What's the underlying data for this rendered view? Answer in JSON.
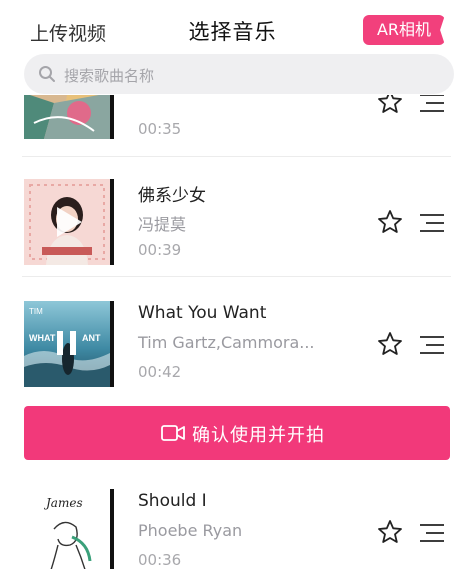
{
  "header": {
    "upload_label": "上传视频",
    "title": "选择音乐",
    "ar_label": "AR相机"
  },
  "search": {
    "placeholder": "搜索歌曲名称",
    "icon": "search-icon"
  },
  "songs": [
    {
      "title": "",
      "artist": "",
      "duration": "00:35",
      "cover": "colorful-art"
    },
    {
      "title": "佛系少女",
      "artist": "冯提莫",
      "duration": "00:39",
      "cover": "pink-portrait",
      "state": "playing"
    },
    {
      "title": "What You Want",
      "artist": "Tim Gartz,Cammora...",
      "duration": "00:42",
      "cover": "ocean-scene",
      "state": "paused"
    },
    {
      "title": "Should I",
      "artist": "Phoebe Ryan",
      "duration": "00:36",
      "cover": "line-drawing",
      "cover_script": "James"
    }
  ],
  "confirm": {
    "label": "确认使用并开拍",
    "icon": "video-camera-icon"
  },
  "colors": {
    "accent": "#f2397a",
    "muted": "#9a9aa0",
    "search_bg": "#efeff1"
  }
}
